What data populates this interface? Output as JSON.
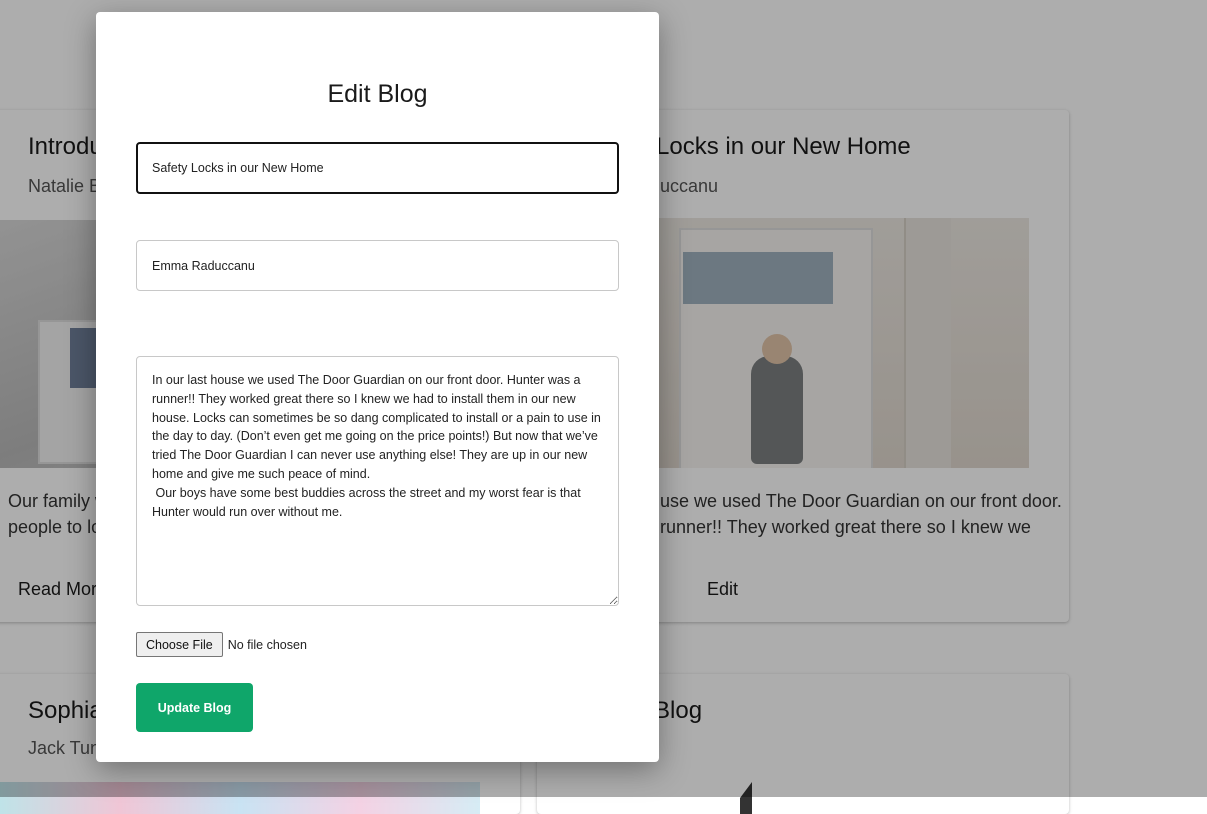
{
  "background": {
    "cards": [
      {
        "title": "Introdu",
        "author": "Natalie B",
        "excerpt_lines": [
          "Our family w",
          "people to lo"
        ],
        "action": "Read More"
      },
      {
        "title": "Locks in our New Home",
        "author": "iuccanu",
        "excerpt_lines": [
          "use we used The Door Guardian on our front door.",
          "runner!! They worked great there so I knew we"
        ],
        "action": "Edit"
      },
      {
        "title": "Sophia",
        "author": "Jack Tun"
      },
      {
        "title": "Blog"
      }
    ]
  },
  "modal": {
    "title": "Edit Blog",
    "title_field": {
      "value": "Safety Locks in our New Home"
    },
    "author_field": {
      "value": "Emma Raduccanu"
    },
    "content_field": {
      "value": "In our last house we used The Door Guardian on our front door. Hunter was a runner!! They worked great there so I knew we had to install them in our new house. Locks can sometimes be so dang complicated to install or a pain to use in the day to day. (Don’t even get me going on the price points!) But now that we’ve tried The Door Guardian I can never use anything else! They are up in our new home and give me such peace of mind.\n Our boys have some best buddies across the street and my worst fear is that Hunter would run over without me."
    },
    "file_input": {
      "button_label": "Choose File",
      "status": "No file chosen"
    },
    "submit_label": "Update Blog"
  },
  "colors": {
    "accent": "#0fa66a",
    "overlay": "rgba(0,0,0,0.32)"
  }
}
